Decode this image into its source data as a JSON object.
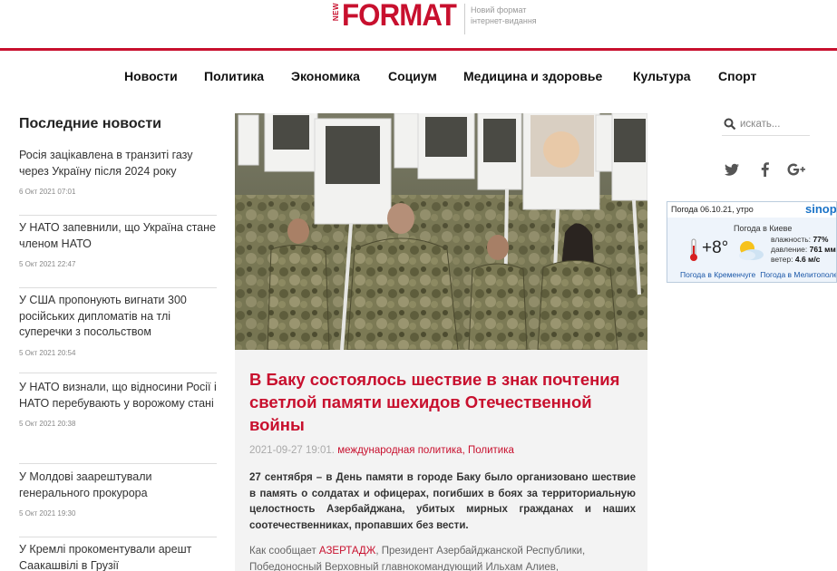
{
  "header": {
    "logo_new": "NEW",
    "logo_format": "FORMAT",
    "tagline": "Новий формат інтернет-видання"
  },
  "nav": [
    "Новости",
    "Политика",
    "Экономика",
    "Социум",
    "Медицина и здоровье",
    "Культура",
    "Спорт"
  ],
  "sidebar": {
    "title": "Последние новости",
    "items": [
      {
        "title": "Росія зацікавлена в транзиті газу через Україну після 2024 року",
        "date": "6 Окт 2021 07:01"
      },
      {
        "title": "У НАТО запевнили, що Україна стане членом НАТО",
        "date": "5 Окт 2021 22:47"
      },
      {
        "title": "У США пропонують вигнати 300 російських дипломатів на тлі суперечки з посольством",
        "date": "5 Окт 2021 20:54"
      },
      {
        "title": "У НАТО визнали, що відносини Росії і НАТО перебувають у ворожому стані",
        "date": "5 Окт 2021 20:38"
      },
      {
        "title": "У Молдові заарештували генерального прокурора",
        "date": "5 Окт 2021 19:30"
      },
      {
        "title": "У Кремлі прокоментували арешт Саакашвілі в Грузії",
        "date": ""
      }
    ]
  },
  "article": {
    "title": "В Баку состоялось шествие в знак почтения светлой памяти шехидов Отечественной войны",
    "date": "2021-09-27 19:01.",
    "categories": "международная политика, Политика",
    "lead": "27 сентября – в День памяти в городе Баку было организовано шествие в память о солдатах и офицерах, погибших в боях за территориальную целостность Азербайджана, убитых мирных гражданах и наших соотечественниках, пропавших без вести.",
    "body_prefix": "Как сообщает ",
    "body_source": "АЗЕРТАДЖ",
    "body_text": ", Президент Азербайджанской Республики, Победоносный Верховный главнокомандующий Ильхам Алиев,"
  },
  "search": {
    "placeholder": "искать..."
  },
  "social": [
    "twitter-icon",
    "facebook-icon",
    "google-plus-icon"
  ],
  "weather": {
    "date": "Погода 06.10.21, утро",
    "logo": "sinop",
    "city": "Погода в Киеве",
    "temp": "+8°",
    "humidity_label": "влажность:",
    "humidity": "77%",
    "pressure_label": "давление:",
    "pressure": "761 мм",
    "wind_label": "ветер:",
    "wind": "4.6 м/с",
    "link1": "Погода в Кременчуге",
    "link2": "Погода в Мелитополе"
  },
  "colors": {
    "accent": "#c8102e",
    "weather_blue": "#1a73c8"
  }
}
